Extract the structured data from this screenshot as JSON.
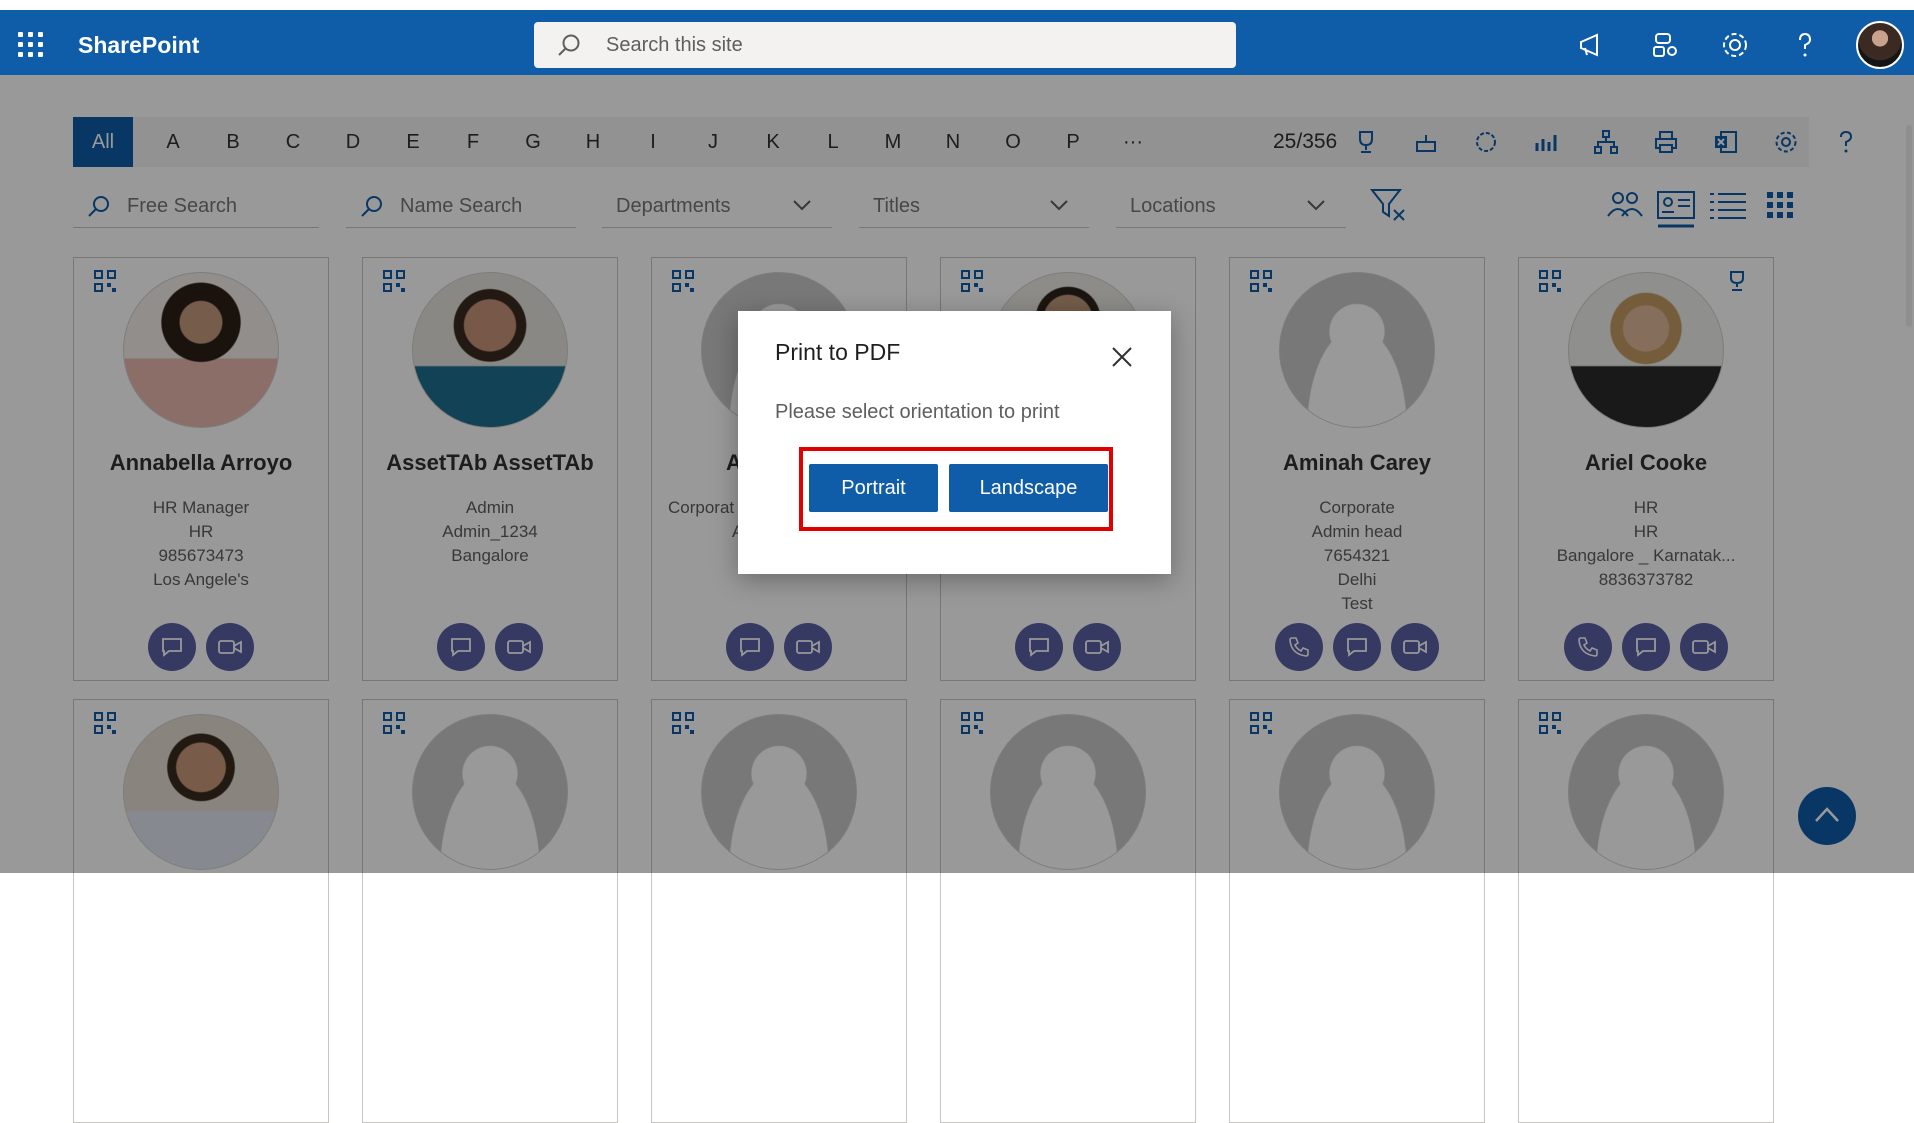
{
  "suite": {
    "brand": "SharePoint",
    "search_placeholder": "Search this site"
  },
  "toolbar": {
    "letters": [
      "All",
      "A",
      "B",
      "C",
      "D",
      "E",
      "F",
      "G",
      "H",
      "I",
      "J",
      "K",
      "L",
      "M",
      "N",
      "O",
      "P",
      "···"
    ],
    "count": "25/356"
  },
  "filters": {
    "free_search": "Free Search",
    "name_search": "Name Search",
    "departments": "Departments",
    "titles": "Titles",
    "locations": "Locations"
  },
  "cards": [
    {
      "name": "Annabella Arroyo",
      "lines": [
        "HR Manager",
        "HR",
        "985673473",
        "Los Angele's"
      ]
    },
    {
      "name": "AssetTAb AssetTAb",
      "lines": [
        "Admin",
        "Admin_1234",
        "Bangalore"
      ]
    },
    {
      "name": "Al",
      "lines": [
        "Corporat",
        "A",
        ""
      ]
    },
    {
      "name": "",
      "lines": []
    },
    {
      "name": "Aminah Carey",
      "lines": [
        "Corporate",
        "Admin head",
        "7654321",
        "Delhi",
        "Test"
      ]
    },
    {
      "name": "Ariel Cooke",
      "lines": [
        "HR",
        "HR",
        "Bangalore _ Karnatak...",
        "8836373782"
      ]
    }
  ],
  "dialog": {
    "title": "Print to PDF",
    "message": "Please select orientation to print",
    "portrait": "Portrait",
    "landscape": "Landscape"
  },
  "colors": {
    "brand": "#0f5ca8",
    "action": "#5b5fa3",
    "highlight": "#e00000"
  }
}
